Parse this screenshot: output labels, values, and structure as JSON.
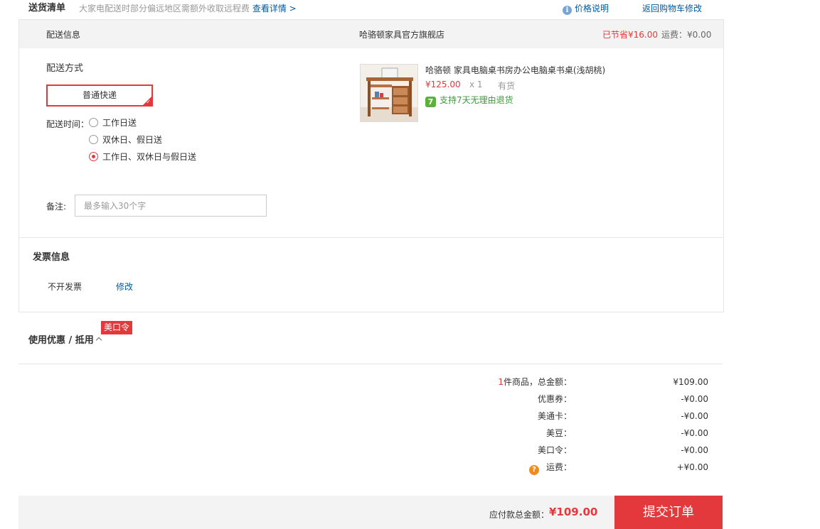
{
  "top": {
    "title": "送货清单",
    "desc": "大家电配送时部分偏远地区需额外收取远程费",
    "detail_link": "查看详情 >",
    "price_explain": "价格说明",
    "back_cart": "返回购物车修改"
  },
  "header": {
    "shipping_info": "配送信息",
    "store": "哈骆顿家具官方旗舰店",
    "saved": "已节省¥16.00",
    "fee": "运费：¥0.00"
  },
  "shipping": {
    "method_label": "配送方式",
    "method_selected": "普通快递",
    "time_label": "配送时间：",
    "options": [
      {
        "label": "工作日送",
        "checked": false
      },
      {
        "label": "双休日、假日送",
        "checked": false
      },
      {
        "label": "工作日、双休日与假日送",
        "checked": true
      }
    ],
    "note_label": "备注:",
    "note_placeholder": "最多输入30个字",
    "note_value": ""
  },
  "product": {
    "name": "哈骆顿 家具电脑桌书房办公电脑桌书桌(浅胡桃)",
    "price": "¥125.00",
    "qty": "x 1",
    "stock": "有货",
    "return_icon": "7",
    "return_text": "支持7天无理由退货"
  },
  "invoice": {
    "title": "发票信息",
    "value": "不开发票",
    "edit": "修改"
  },
  "coupon": {
    "title": "使用优惠 / 抵用",
    "tag": "美口令"
  },
  "summary": {
    "count": "1",
    "count_suffix": "件商品，总金额：",
    "total": "¥109.00",
    "rows": [
      {
        "label": "优惠券：",
        "value": "-¥0.00"
      },
      {
        "label": "美通卡：",
        "value": "-¥0.00"
      },
      {
        "label": "美豆：",
        "value": "-¥0.00"
      },
      {
        "label": "美口令：",
        "value": "-¥0.00"
      },
      {
        "label": "运费：",
        "value": "+¥0.00"
      }
    ]
  },
  "footer": {
    "label": "应付款总金额：",
    "total": "¥109.00",
    "submit": "提交订单"
  },
  "colors": {
    "accent": "#e4393c",
    "link": "#005aa0",
    "header_bg": "#f3f3f3",
    "green": "#5cb13d"
  }
}
